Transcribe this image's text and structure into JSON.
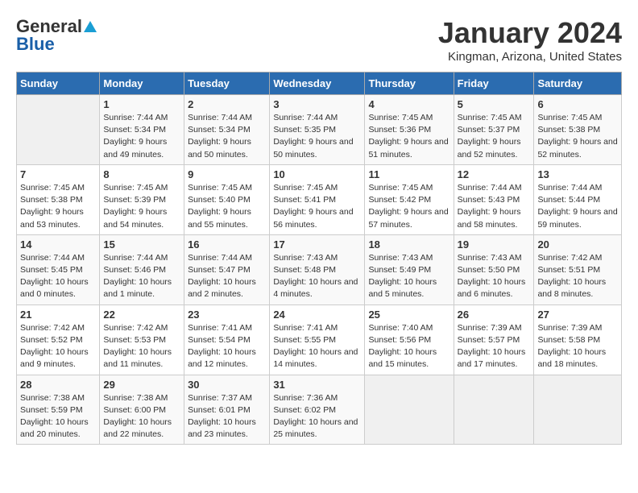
{
  "header": {
    "logo_general": "General",
    "logo_blue": "Blue",
    "month_title": "January 2024",
    "location": "Kingman, Arizona, United States"
  },
  "days_of_week": [
    "Sunday",
    "Monday",
    "Tuesday",
    "Wednesday",
    "Thursday",
    "Friday",
    "Saturday"
  ],
  "weeks": [
    [
      {
        "day": "",
        "sunrise": "",
        "sunset": "",
        "daylight": ""
      },
      {
        "day": "1",
        "sunrise": "7:44 AM",
        "sunset": "5:34 PM",
        "daylight": "9 hours and 49 minutes."
      },
      {
        "day": "2",
        "sunrise": "7:44 AM",
        "sunset": "5:34 PM",
        "daylight": "9 hours and 50 minutes."
      },
      {
        "day": "3",
        "sunrise": "7:44 AM",
        "sunset": "5:35 PM",
        "daylight": "9 hours and 50 minutes."
      },
      {
        "day": "4",
        "sunrise": "7:45 AM",
        "sunset": "5:36 PM",
        "daylight": "9 hours and 51 minutes."
      },
      {
        "day": "5",
        "sunrise": "7:45 AM",
        "sunset": "5:37 PM",
        "daylight": "9 hours and 52 minutes."
      },
      {
        "day": "6",
        "sunrise": "7:45 AM",
        "sunset": "5:38 PM",
        "daylight": "9 hours and 52 minutes."
      }
    ],
    [
      {
        "day": "7",
        "sunrise": "7:45 AM",
        "sunset": "5:38 PM",
        "daylight": "9 hours and 53 minutes."
      },
      {
        "day": "8",
        "sunrise": "7:45 AM",
        "sunset": "5:39 PM",
        "daylight": "9 hours and 54 minutes."
      },
      {
        "day": "9",
        "sunrise": "7:45 AM",
        "sunset": "5:40 PM",
        "daylight": "9 hours and 55 minutes."
      },
      {
        "day": "10",
        "sunrise": "7:45 AM",
        "sunset": "5:41 PM",
        "daylight": "9 hours and 56 minutes."
      },
      {
        "day": "11",
        "sunrise": "7:45 AM",
        "sunset": "5:42 PM",
        "daylight": "9 hours and 57 minutes."
      },
      {
        "day": "12",
        "sunrise": "7:44 AM",
        "sunset": "5:43 PM",
        "daylight": "9 hours and 58 minutes."
      },
      {
        "day": "13",
        "sunrise": "7:44 AM",
        "sunset": "5:44 PM",
        "daylight": "9 hours and 59 minutes."
      }
    ],
    [
      {
        "day": "14",
        "sunrise": "7:44 AM",
        "sunset": "5:45 PM",
        "daylight": "10 hours and 0 minutes."
      },
      {
        "day": "15",
        "sunrise": "7:44 AM",
        "sunset": "5:46 PM",
        "daylight": "10 hours and 1 minute."
      },
      {
        "day": "16",
        "sunrise": "7:44 AM",
        "sunset": "5:47 PM",
        "daylight": "10 hours and 2 minutes."
      },
      {
        "day": "17",
        "sunrise": "7:43 AM",
        "sunset": "5:48 PM",
        "daylight": "10 hours and 4 minutes."
      },
      {
        "day": "18",
        "sunrise": "7:43 AM",
        "sunset": "5:49 PM",
        "daylight": "10 hours and 5 minutes."
      },
      {
        "day": "19",
        "sunrise": "7:43 AM",
        "sunset": "5:50 PM",
        "daylight": "10 hours and 6 minutes."
      },
      {
        "day": "20",
        "sunrise": "7:42 AM",
        "sunset": "5:51 PM",
        "daylight": "10 hours and 8 minutes."
      }
    ],
    [
      {
        "day": "21",
        "sunrise": "7:42 AM",
        "sunset": "5:52 PM",
        "daylight": "10 hours and 9 minutes."
      },
      {
        "day": "22",
        "sunrise": "7:42 AM",
        "sunset": "5:53 PM",
        "daylight": "10 hours and 11 minutes."
      },
      {
        "day": "23",
        "sunrise": "7:41 AM",
        "sunset": "5:54 PM",
        "daylight": "10 hours and 12 minutes."
      },
      {
        "day": "24",
        "sunrise": "7:41 AM",
        "sunset": "5:55 PM",
        "daylight": "10 hours and 14 minutes."
      },
      {
        "day": "25",
        "sunrise": "7:40 AM",
        "sunset": "5:56 PM",
        "daylight": "10 hours and 15 minutes."
      },
      {
        "day": "26",
        "sunrise": "7:39 AM",
        "sunset": "5:57 PM",
        "daylight": "10 hours and 17 minutes."
      },
      {
        "day": "27",
        "sunrise": "7:39 AM",
        "sunset": "5:58 PM",
        "daylight": "10 hours and 18 minutes."
      }
    ],
    [
      {
        "day": "28",
        "sunrise": "7:38 AM",
        "sunset": "5:59 PM",
        "daylight": "10 hours and 20 minutes."
      },
      {
        "day": "29",
        "sunrise": "7:38 AM",
        "sunset": "6:00 PM",
        "daylight": "10 hours and 22 minutes."
      },
      {
        "day": "30",
        "sunrise": "7:37 AM",
        "sunset": "6:01 PM",
        "daylight": "10 hours and 23 minutes."
      },
      {
        "day": "31",
        "sunrise": "7:36 AM",
        "sunset": "6:02 PM",
        "daylight": "10 hours and 25 minutes."
      },
      {
        "day": "",
        "sunrise": "",
        "sunset": "",
        "daylight": ""
      },
      {
        "day": "",
        "sunrise": "",
        "sunset": "",
        "daylight": ""
      },
      {
        "day": "",
        "sunrise": "",
        "sunset": "",
        "daylight": ""
      }
    ]
  ]
}
